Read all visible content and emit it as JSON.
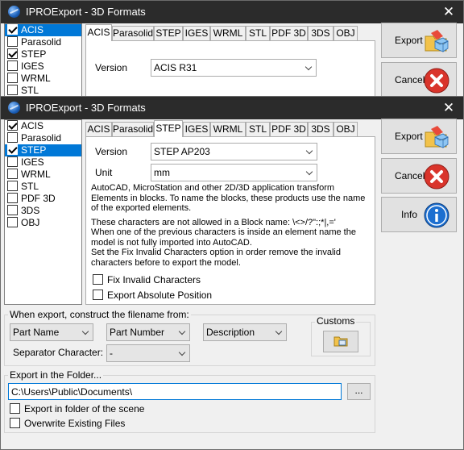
{
  "back_window": {
    "title": "IPROExport - 3D Formats",
    "close_glyph": "✕",
    "formats": [
      {
        "label": "ACIS",
        "checked": true,
        "selected": true
      },
      {
        "label": "Parasolid",
        "checked": false,
        "selected": false
      },
      {
        "label": "STEP",
        "checked": true,
        "selected": false
      },
      {
        "label": "IGES",
        "checked": false,
        "selected": false
      },
      {
        "label": "WRML",
        "checked": false,
        "selected": false
      },
      {
        "label": "STL",
        "checked": false,
        "selected": false
      }
    ],
    "tabs": [
      "ACIS",
      "Parasolid",
      "STEP",
      "IGES",
      "WRML",
      "STL",
      "PDF 3D",
      "3DS",
      "OBJ"
    ],
    "active_tab": "ACIS",
    "version_label": "Version",
    "version_value": "ACIS R31",
    "export_label": "Export",
    "cancel_label": "Cancel"
  },
  "window": {
    "title": "IPROExport - 3D Formats",
    "close_glyph": "✕",
    "formats": [
      {
        "label": "ACIS",
        "checked": true,
        "selected": false
      },
      {
        "label": "Parasolid",
        "checked": false,
        "selected": false
      },
      {
        "label": "STEP",
        "checked": true,
        "selected": true
      },
      {
        "label": "IGES",
        "checked": false,
        "selected": false
      },
      {
        "label": "WRML",
        "checked": false,
        "selected": false
      },
      {
        "label": "STL",
        "checked": false,
        "selected": false
      },
      {
        "label": "PDF 3D",
        "checked": false,
        "selected": false
      },
      {
        "label": "3DS",
        "checked": false,
        "selected": false
      },
      {
        "label": "OBJ",
        "checked": false,
        "selected": false
      }
    ],
    "tabs": [
      "ACIS",
      "Parasolid",
      "STEP",
      "IGES",
      "WRML",
      "STL",
      "PDF 3D",
      "3DS",
      "OBJ"
    ],
    "active_tab": "STEP",
    "version_label": "Version",
    "version_value": "STEP AP203",
    "unit_label": "Unit",
    "unit_value": "mm",
    "info_text_1": "AutoCAD, MicroStation and other 2D/3D application transform Elements in blocks. To name the blocks, these products use the name of the exported elements.",
    "info_text_2": "These characters are not allowed in a Block name:   \\<>/?\":;*|,='",
    "info_text_3": "When one of the previous characters is inside an element name the model is not fully imported into AutoCAD.",
    "info_text_4": "Set the Fix Invalid Characters option in order remove the invalid characters before to export the model.",
    "fix_invalid_label": "Fix Invalid Characters",
    "export_absolute_label": "Export Absolute Position",
    "buttons": {
      "export": "Export",
      "cancel": "Cancel",
      "info": "Info"
    },
    "filename_group": {
      "title": "When export, construct the filename from:",
      "combo1": "Part Name",
      "combo2": "Part Number",
      "combo3": "Description",
      "separator_label": "Separator Character:",
      "separator_value": "-",
      "customs_title": "Customs"
    },
    "folder_group": {
      "title": "Export in the Folder...",
      "path_value": "C:\\Users\\Public\\Documents\\",
      "browse_label": "...",
      "scene_folder_label": "Export in folder of the scene",
      "overwrite_label": "Overwrite Existing Files"
    }
  },
  "colors": {
    "selection": "#0078d7",
    "titlebar": "#2b2b2b",
    "window_bg": "#f0f0f0",
    "cancel_red": "#d9342b",
    "info_blue": "#1c6fd0"
  }
}
